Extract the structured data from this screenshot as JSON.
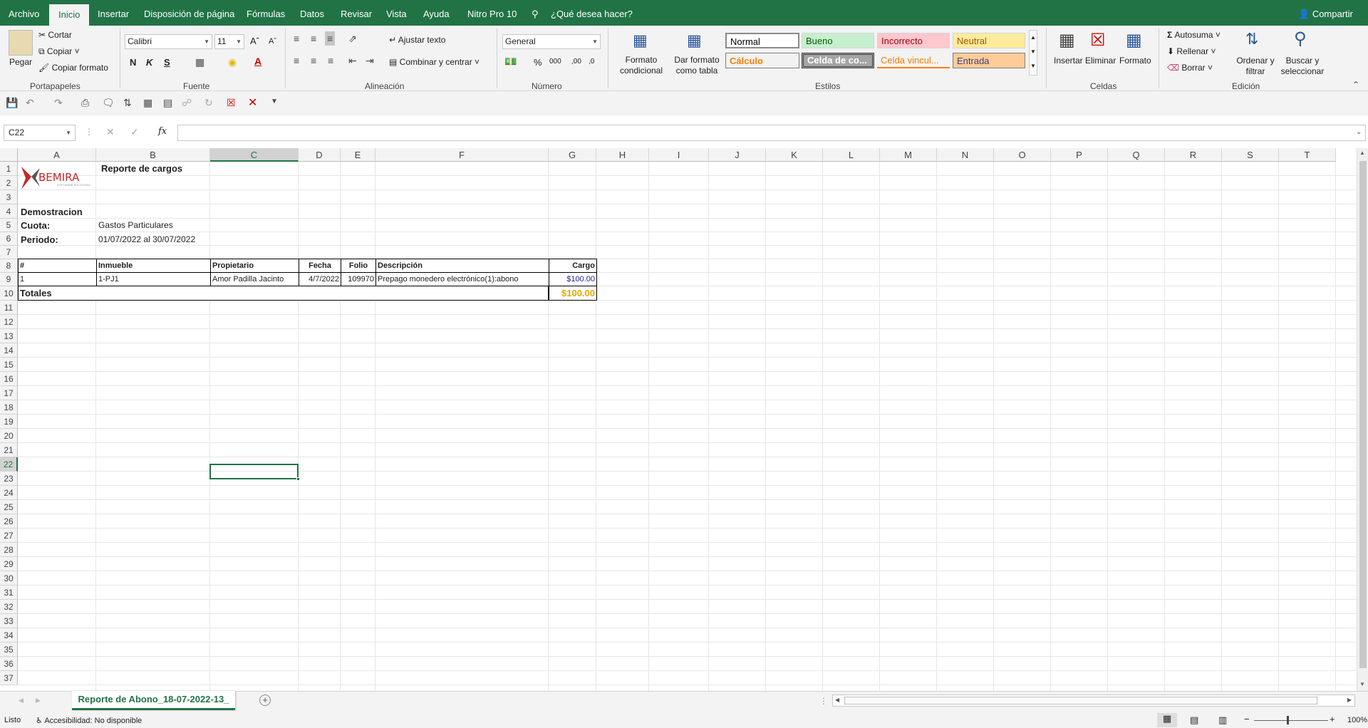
{
  "ribbon_tabs": [
    "Archivo",
    "Inicio",
    "Insertar",
    "Disposición de página",
    "Fórmulas",
    "Datos",
    "Revisar",
    "Vista",
    "Ayuda",
    "Nitro Pro 10"
  ],
  "tell_me": "¿Qué desea hacer?",
  "share": "Compartir",
  "clipboard": {
    "paste": "Pegar",
    "cut": "Cortar",
    "copy": "Copiar",
    "format_painter": "Copiar formato",
    "group": "Portapapeles"
  },
  "font": {
    "name": "Calibri",
    "size": "11",
    "bold": "N",
    "italic": "K",
    "underline": "S",
    "group": "Fuente"
  },
  "alignment": {
    "wrap": "Ajustar texto",
    "merge": "Combinar y centrar",
    "group": "Alineación"
  },
  "number": {
    "format": "General",
    "group": "Número"
  },
  "styles": {
    "cond_format": "Formato condicional",
    "table_format": "Dar formato como tabla",
    "normal": "Normal",
    "bueno": "Bueno",
    "incorrecto": "Incorrecto",
    "neutral": "Neutral",
    "calculo": "Cálculo",
    "celda_co": "Celda de co...",
    "celda_vinc": "Celda vincul...",
    "entrada": "Entrada",
    "group": "Estilos"
  },
  "cells": {
    "insert": "Insertar",
    "delete": "Eliminar",
    "format": "Formato",
    "group": "Celdas"
  },
  "editing": {
    "autosum": "Autosuma",
    "fill": "Rellenar",
    "clear": "Borrar",
    "sort": "Ordenar y filtrar",
    "find": "Buscar y seleccionar",
    "group": "Edición"
  },
  "name_box": "C22",
  "fx": "fx",
  "columns": [
    "A",
    "B",
    "C",
    "D",
    "E",
    "F",
    "G",
    "H",
    "I",
    "J",
    "K",
    "L",
    "M",
    "N",
    "O",
    "P",
    "Q",
    "R",
    "S",
    "T"
  ],
  "rows": [
    "1",
    "2",
    "3",
    "4",
    "5",
    "6",
    "7",
    "8",
    "9",
    "10",
    "11",
    "12",
    "13",
    "14",
    "15",
    "16",
    "17",
    "18",
    "19",
    "20",
    "21",
    "22",
    "23",
    "24",
    "25",
    "26",
    "27",
    "28",
    "29",
    "30",
    "31",
    "32",
    "33",
    "34",
    "35",
    "36",
    "37"
  ],
  "sheet": {
    "logo_text": "BEMIRA",
    "logo_sub": "SOFTWARE SOLUTIONS",
    "title": "Reporte de cargos",
    "company": "Demostracion",
    "cuota_label": "Cuota:",
    "cuota_value": "Gastos Particulares",
    "periodo_label": "Periodo:",
    "periodo_value": "01/07/2022 al 30/07/2022",
    "headers": [
      "#",
      "Inmueble",
      "Propietario",
      "Fecha",
      "Folio",
      "Descripción",
      "Cargo"
    ],
    "row": [
      "1",
      "1-PJ1",
      "Amor Padilla Jacinto",
      "4/7/2022",
      "109970",
      "Prepago monedero electrónico(1):abono",
      "$100.00"
    ],
    "totals_label": "Totales",
    "totals_value": "$100.00"
  },
  "sheet_tab": "Reporte de Abono_18-07-2022-13_",
  "status": {
    "ready": "Listo",
    "accessibility": "Accesibilidad: No disponible",
    "zoom": "100%"
  }
}
